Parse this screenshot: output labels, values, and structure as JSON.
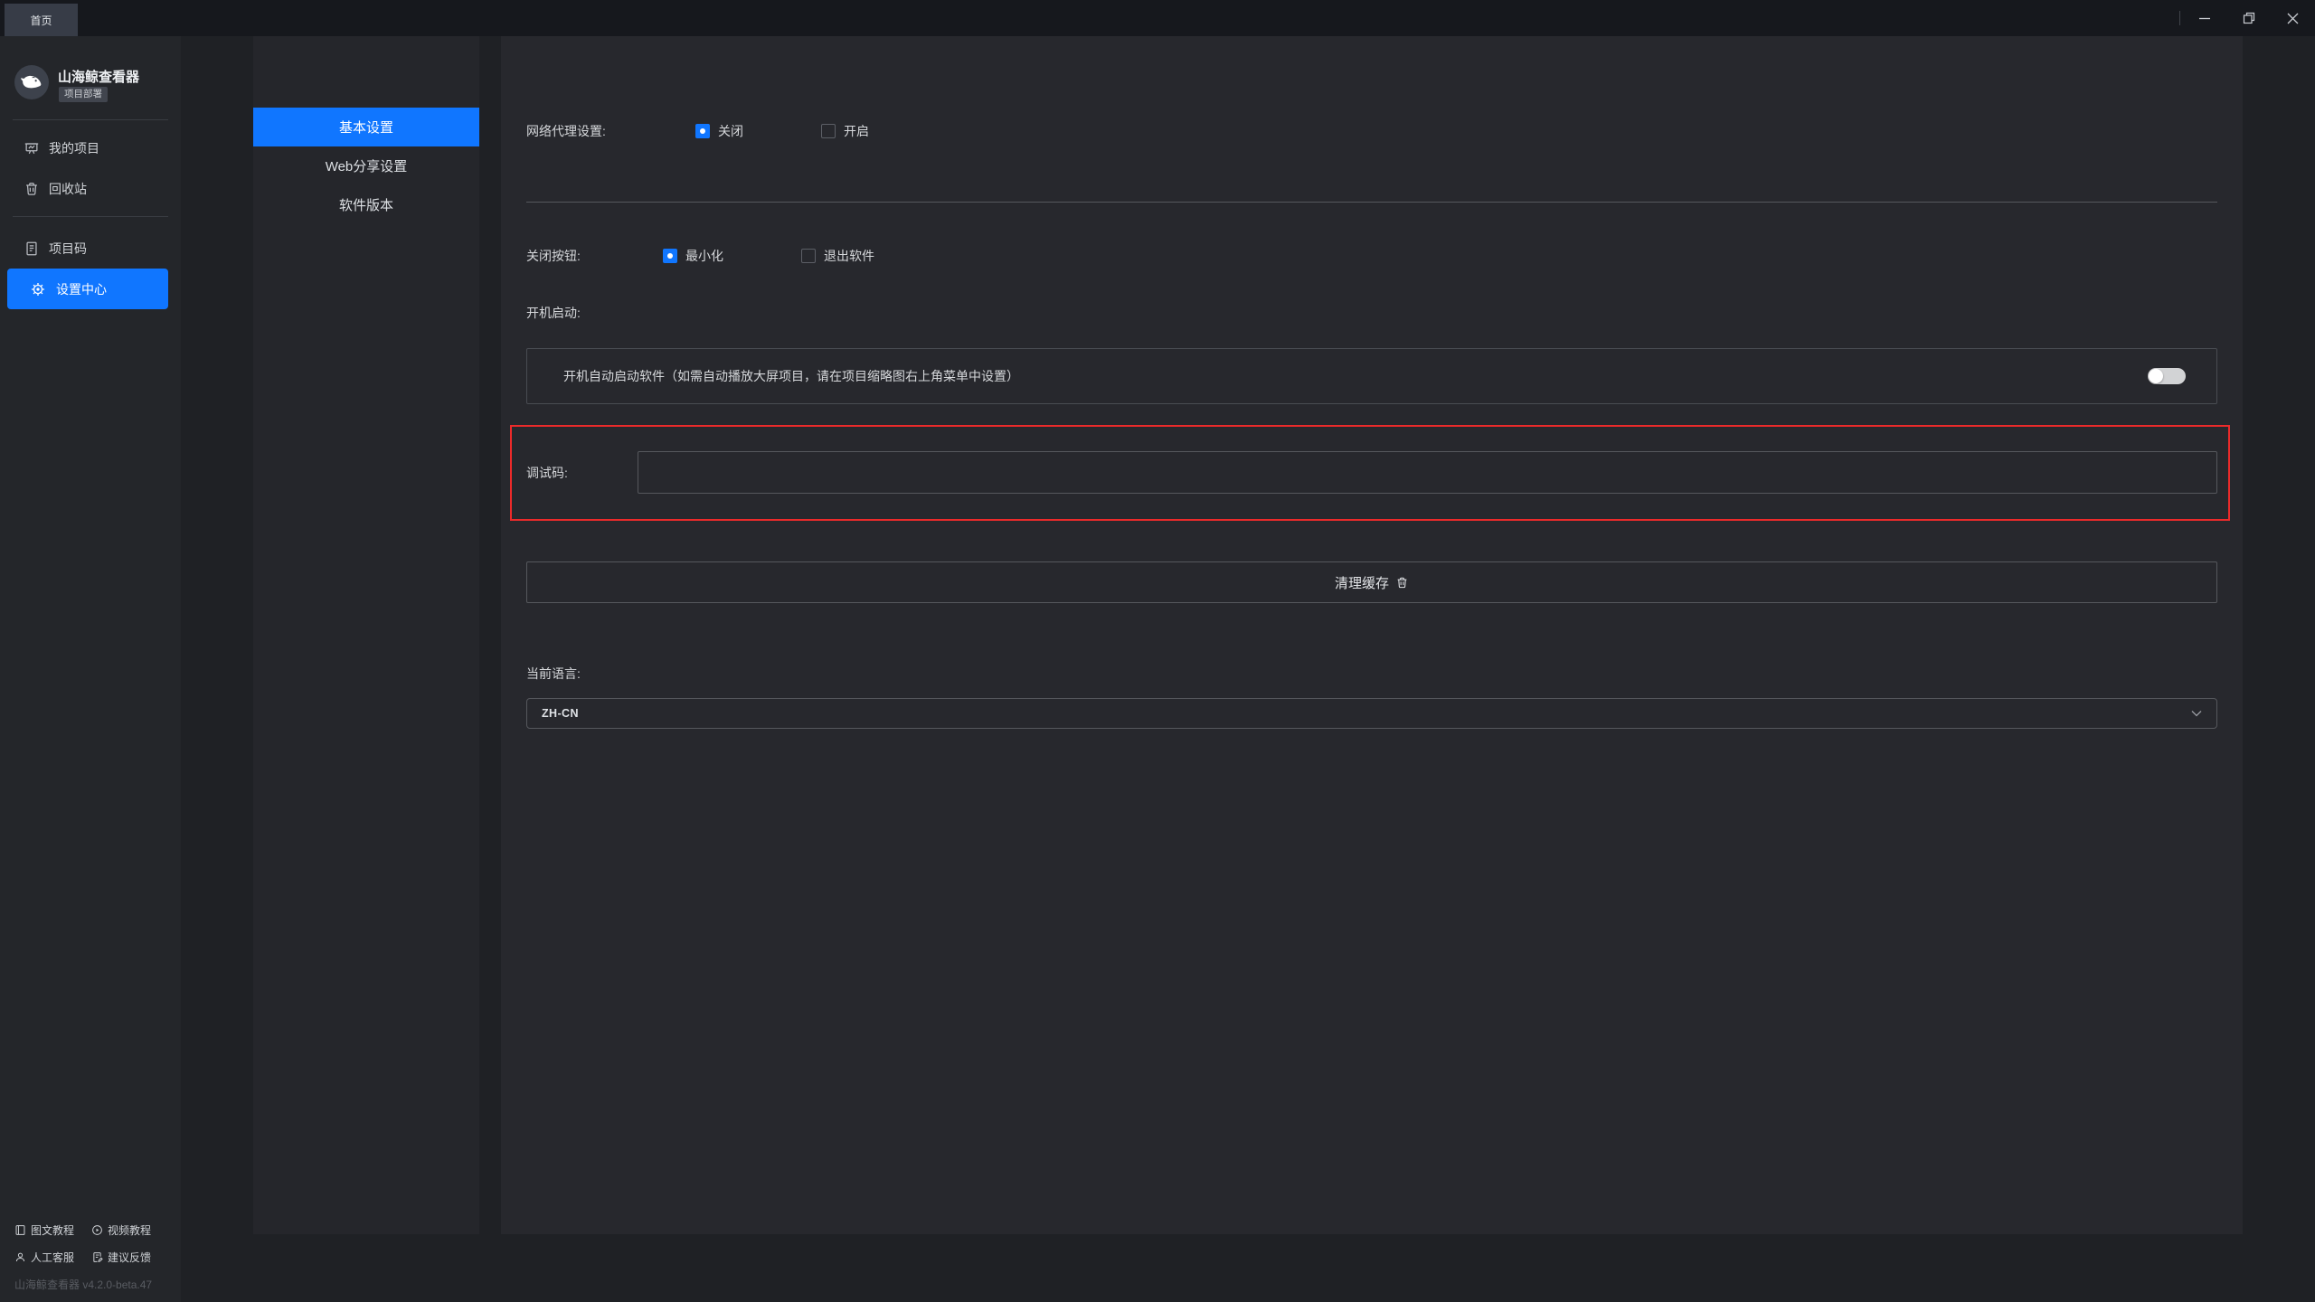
{
  "titlebar": {
    "tab": "首页"
  },
  "app": {
    "name": "山海鲸查看器",
    "badge": "项目部署",
    "version": "山海鲸查看器 v4.2.0-beta.47"
  },
  "sidebar": {
    "items": [
      {
        "label": "我的项目",
        "icon": "projects-board-icon",
        "active": false
      },
      {
        "label": "回收站",
        "icon": "trash-icon",
        "active": false
      },
      {
        "label": "项目码",
        "icon": "project-code-icon",
        "active": false
      },
      {
        "label": "设置中心",
        "icon": "gear-icon",
        "active": true
      }
    ],
    "footer_links": [
      "图文教程",
      "视频教程",
      "人工客服",
      "建议反馈"
    ]
  },
  "settings_nav": {
    "tabs": [
      {
        "label": "基本设置",
        "active": true
      },
      {
        "label": "Web分享设置",
        "active": false
      },
      {
        "label": "软件版本",
        "active": false
      }
    ]
  },
  "content": {
    "proxy": {
      "label": "网络代理设置:",
      "options": [
        {
          "label": "关闭",
          "checked": true
        },
        {
          "label": "开启",
          "checked": false
        }
      ]
    },
    "close_button": {
      "label": "关闭按钮:",
      "options": [
        {
          "label": "最小化",
          "checked": true
        },
        {
          "label": "退出软件",
          "checked": false
        }
      ]
    },
    "startup": {
      "label": "开机启动:",
      "description": "开机自动启动软件（如需自动播放大屏项目，请在项目缩略图右上角菜单中设置）",
      "toggle_on": false
    },
    "debug_code": {
      "label": "调试码:",
      "value": ""
    },
    "clear_cache_label": "清理缓存",
    "language": {
      "label": "当前语言:",
      "selected": "ZH-CN"
    }
  },
  "colors": {
    "accent": "#1076ff",
    "highlight_red": "#ec2a2a"
  }
}
